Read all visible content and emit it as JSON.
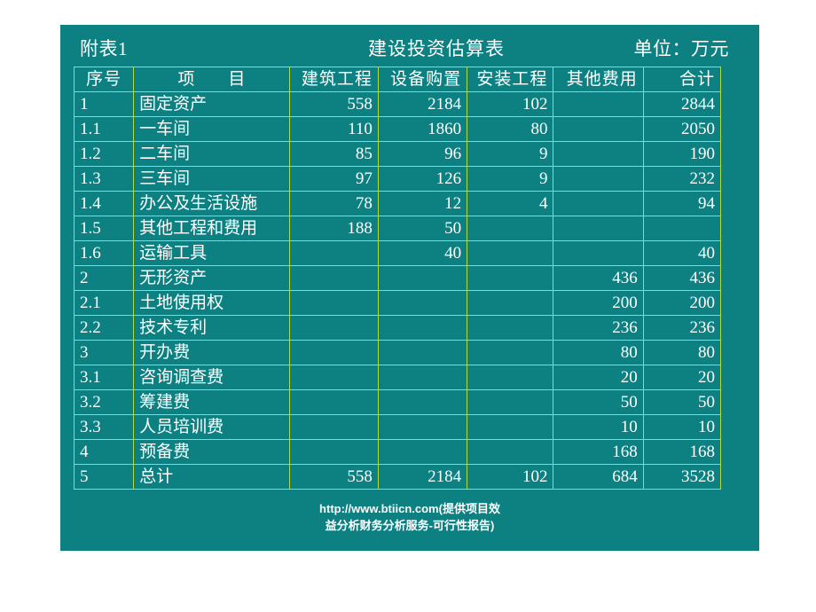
{
  "slide": {
    "sheet_number": "附表1",
    "title": "建设投资估算表",
    "unit": "单位：万元",
    "watermark_line1": "http://www.btiicn.com(提供项目效",
    "watermark_line2": "益分析财务分析服务-可行性报告)",
    "colors": {
      "panel_background": "#0d8082",
      "grid_border": "#b4dc36",
      "text": "#ffffff",
      "red_value": "#8f2f2f",
      "page_background": "#ffffff"
    }
  },
  "table": {
    "headers": [
      "序号",
      "项　　目",
      "建筑工程",
      "设备购置",
      "安装工程",
      "其他费用",
      "合计"
    ],
    "rows": [
      {
        "no": "1",
        "item": "固定资产",
        "c1": "558",
        "c1r": false,
        "c2": "2184",
        "c2r": false,
        "c3": "102",
        "c3r": false,
        "c4": "",
        "c4r": false,
        "total": "2844",
        "totr": false
      },
      {
        "no": "1.1",
        "item": "一车间",
        "c1": "110",
        "c1r": true,
        "c2": "1860",
        "c2r": true,
        "c3": "80",
        "c3r": true,
        "c4": "",
        "c4r": false,
        "total": "2050",
        "totr": false
      },
      {
        "no": "1.2",
        "item": "二车间",
        "c1": "85",
        "c1r": true,
        "c2": "96",
        "c2r": true,
        "c3": "9",
        "c3r": true,
        "c4": "",
        "c4r": false,
        "total": "190",
        "totr": false
      },
      {
        "no": "1.3",
        "item": "三车间",
        "c1": "97",
        "c1r": true,
        "c2": "126",
        "c2r": true,
        "c3": "9",
        "c3r": true,
        "c4": "",
        "c4r": false,
        "total": "232",
        "totr": false
      },
      {
        "no": "1.4",
        "item": "办公及生活设施",
        "c1": "78",
        "c1r": true,
        "c2": "12",
        "c2r": true,
        "c3": "4",
        "c3r": true,
        "c4": "",
        "c4r": false,
        "total": "94",
        "totr": false
      },
      {
        "no": "1.5",
        "item": "其他工程和费用",
        "c1": "188",
        "c1r": true,
        "c2": "50",
        "c2r": true,
        "c3": "",
        "c3r": false,
        "c4": "",
        "c4r": false,
        "total": "",
        "totr": false
      },
      {
        "no": "1.6",
        "item": "运输工具",
        "c1": "",
        "c1r": false,
        "c2": "40",
        "c2r": false,
        "c3": "",
        "c3r": false,
        "c4": "",
        "c4r": false,
        "total": "40",
        "totr": false
      },
      {
        "no": "2",
        "item": "无形资产",
        "c1": "",
        "c1r": false,
        "c2": "",
        "c2r": false,
        "c3": "",
        "c3r": false,
        "c4": "436",
        "c4r": false,
        "total": "436",
        "totr": false
      },
      {
        "no": "2.1",
        "item": "土地使用权",
        "c1": "",
        "c1r": false,
        "c2": "",
        "c2r": false,
        "c3": "",
        "c3r": false,
        "c4": "200",
        "c4r": true,
        "total": "200",
        "totr": false
      },
      {
        "no": "2.2",
        "item": "技术专利",
        "c1": "",
        "c1r": false,
        "c2": "",
        "c2r": false,
        "c3": "",
        "c3r": false,
        "c4": "236",
        "c4r": true,
        "total": "236",
        "totr": false
      },
      {
        "no": "3",
        "item": "开办费",
        "c1": "",
        "c1r": false,
        "c2": "",
        "c2r": false,
        "c3": "",
        "c3r": false,
        "c4": "80",
        "c4r": false,
        "total": "80",
        "totr": false
      },
      {
        "no": "3.1",
        "item": "咨询调查费",
        "c1": "",
        "c1r": false,
        "c2": "",
        "c2r": false,
        "c3": "",
        "c3r": false,
        "c4": "20",
        "c4r": true,
        "total": "20",
        "totr": false
      },
      {
        "no": "3.2",
        "item": "筹建费",
        "c1": "",
        "c1r": false,
        "c2": "",
        "c2r": false,
        "c3": "",
        "c3r": false,
        "c4": "50",
        "c4r": true,
        "total": "50",
        "totr": false
      },
      {
        "no": "3.3",
        "item": "人员培训费",
        "c1": "",
        "c1r": false,
        "c2": "",
        "c2r": false,
        "c3": "",
        "c3r": false,
        "c4": "10",
        "c4r": true,
        "total": "10",
        "totr": false
      },
      {
        "no": "4",
        "item": "预备费",
        "c1": "",
        "c1r": false,
        "c2": "",
        "c2r": false,
        "c3": "",
        "c3r": false,
        "c4": "168",
        "c4r": false,
        "total": "168",
        "totr": false
      },
      {
        "no": "5",
        "item": "总计",
        "c1": "558",
        "c1r": false,
        "c2": "2184",
        "c2r": false,
        "c3": "102",
        "c3r": false,
        "c4": "684",
        "c4r": false,
        "total": "3528",
        "totr": false
      }
    ]
  }
}
